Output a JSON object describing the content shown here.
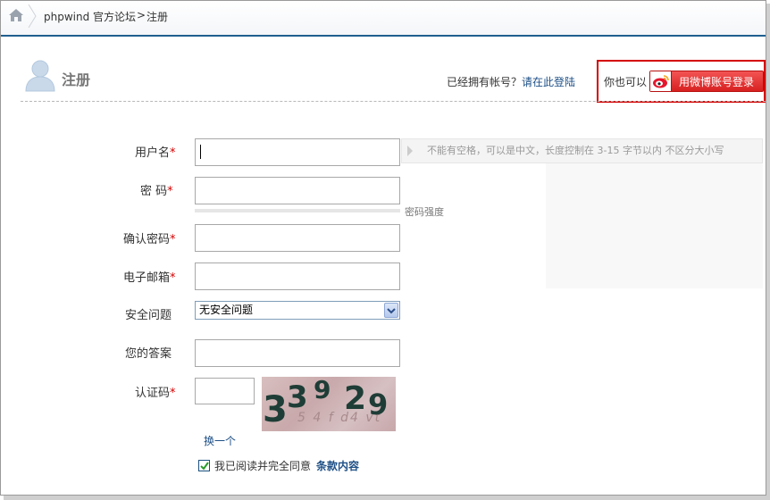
{
  "breadcrumb": {
    "home_icon": "home-icon",
    "forum": "phpwind 官方论坛",
    "separator": ">",
    "current": "注册"
  },
  "header": {
    "title": "注册",
    "have_account": "已经拥有帐号？",
    "login_link": "请在此登陆",
    "also_can": "你也可以",
    "weibo_button": "用微博账号登录"
  },
  "form": {
    "username_label": "用户名",
    "username_hint": "不能有空格，可以是中文，长度控制在  3-15 字节以内  不区分大小写",
    "username_value": "",
    "password_label": "密  码",
    "password_strength": "密码强度",
    "confirm_label": "确认密码",
    "email_label": "电子邮箱",
    "question_label": "安全问题",
    "question_selected": "无安全问题",
    "answer_label": "您的答案",
    "captcha_label": "认证码",
    "captcha_text": "33929",
    "refresh": "换一个",
    "agree_text": "我已阅读并完全同意",
    "terms_link": "条款内容",
    "required_mark": "*"
  },
  "colors": {
    "accent": "#1f5f8f",
    "required": "#d40000",
    "weibo": "#d82020",
    "link": "#1d4f86"
  }
}
